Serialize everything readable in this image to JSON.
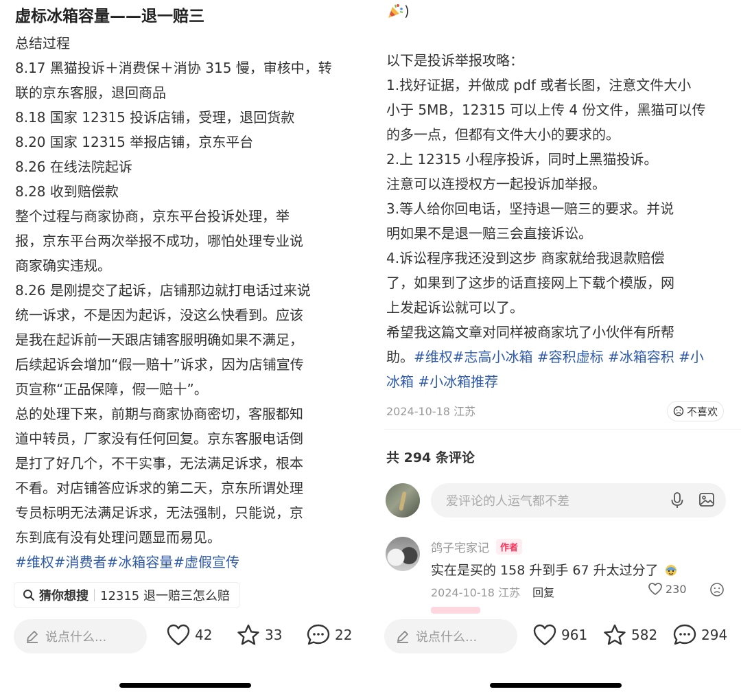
{
  "left": {
    "title": "虚标冰箱容量——退一赔三",
    "lines": [
      "总结过程",
      "8.17 黑猫投诉＋消费保＋消协 315 慢，审核中，转",
      "联的京东客服，退回商品",
      "8.18 国家 12315 投诉店铺，受理，退回货款",
      "8.20 国家 12315 举报店铺，京东平台",
      "8.26 在线法院起诉",
      "8.28 收到赔偿款",
      "整个过程与商家协商，京东平台投诉处理，举",
      "报，京东平台两次举报不成功，哪怕处理专业说",
      "商家确实违规。",
      "8.26 是刚提交了起诉，店铺那边就打电话过来说",
      "统一诉求，不是因为起诉，没这么快看到。应该",
      "是我在起诉前一天跟店铺客服明确如果不满足，",
      "后续起诉会增加“假一赔十”诉求，因为店铺宣传",
      "页宣称“正品保障，假一赔十”。",
      "总的处理下来，前期与商家协商密切，客服都知",
      "道中转员，厂家没有任何回复。京东客服电话倒",
      "是打了好几个，不干实事，无法满足诉求，根本",
      "不看。对店铺答应诉求的第二天，京东所谓处理",
      "专员标明无法满足诉求，无法强制，只能说，京",
      "东到底有没有处理问题显而易见。"
    ],
    "tags": [
      "#维权",
      "#消费者",
      "#冰箱容量",
      "#虚假宣传"
    ],
    "guess_label": "猜你想搜",
    "guess_query": "12315 退一赔三怎么赔",
    "input_placeholder": "说点什么...",
    "likes": "42",
    "stars": "33",
    "comments": "22"
  },
  "right": {
    "top_fragment": ")",
    "lines": [
      "以下是投诉举报攻略：",
      "1.找好证据，并做成 pdf 或者长图，注意文件大小",
      "小于 5MB，12315 可以上传 4 份文件，黑猫可以传",
      "的多一点，但都有文件大小的要求的。",
      "2.上 12315 小程序投诉，同时上黑猫投诉。",
      "注意可以连授权方一起投诉加举报。",
      "3.等人给你回电话，坚持退一赔三的要求。并说",
      "明如果不是退一赔三会直接诉讼。",
      "4.诉讼程序我还没到这步 商家就给我退款赔偿",
      "了，如果到了这步的话直接网上下载个模版，网",
      "上发起诉讼就可以了。",
      "希望我这篇文章对同样被商家坑了小伙伴有所帮"
    ],
    "last_line_prefix": "助。",
    "tags_line1": [
      "#维权",
      "#志高小冰箱",
      "#容积虚标",
      "#冰箱容积",
      "#小"
    ],
    "tags_line2": [
      "冰箱",
      "#小冰箱推荐"
    ],
    "date": "2024-10-18 江苏",
    "dislike": "不喜欢",
    "comment_count": "共 294 条评论",
    "comment_placeholder": "爱评论的人运气都不差",
    "comment": {
      "author": "鸽子宅家记",
      "badge": "作者",
      "text": "实在是买的 158 升到手 67 升太过分了",
      "date": "2024-10-18 江苏",
      "reply": "回复",
      "likes": "230"
    },
    "input_placeholder": "说点什么...",
    "likes": "961",
    "stars": "582",
    "comments": "294"
  }
}
